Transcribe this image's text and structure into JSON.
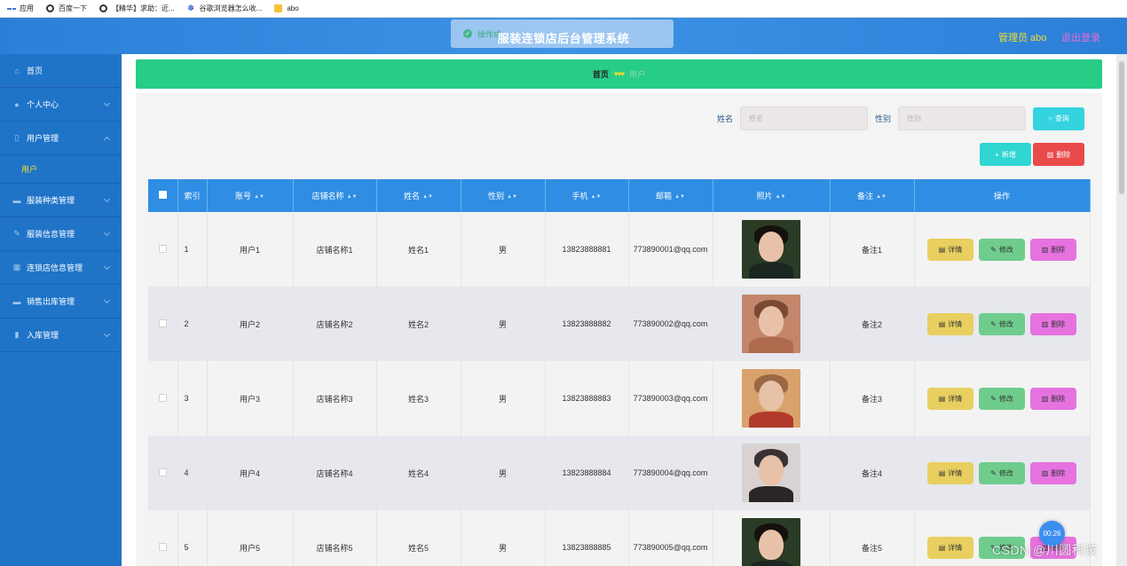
{
  "bookmarks": [
    {
      "label": "应用",
      "icon": "apps-grid-icon"
    },
    {
      "label": "百度一下",
      "icon": "globe-icon"
    },
    {
      "label": "【精华】求助：近...",
      "icon": "globe-icon"
    },
    {
      "label": "谷歌浏览器怎么收...",
      "icon": "paw-icon"
    },
    {
      "label": "abo",
      "icon": "folder-icon"
    }
  ],
  "header": {
    "title": "服装连锁店后台管理系统",
    "toast": "操作成",
    "user_label": "管理员 abo",
    "logout_label": "退出登录"
  },
  "sidebar": {
    "items": [
      {
        "label": "首页",
        "icon": "home-icon",
        "expanded": false,
        "has_children": false
      },
      {
        "label": "个人中心",
        "icon": "user-icon",
        "has_children": true
      },
      {
        "label": "用户管理",
        "icon": "mic-icon",
        "has_children": true,
        "expanded": true,
        "children": [
          {
            "label": "用户"
          }
        ]
      },
      {
        "label": "服装种类管理",
        "icon": "card-icon",
        "has_children": true
      },
      {
        "label": "服装信息管理",
        "icon": "edit-icon",
        "has_children": true
      },
      {
        "label": "连锁店信息管理",
        "icon": "grid-icon",
        "has_children": true
      },
      {
        "label": "销售出库管理",
        "icon": "card-icon",
        "has_children": true
      },
      {
        "label": "入库管理",
        "icon": "bar-chart-icon",
        "has_children": true
      }
    ]
  },
  "breadcrumb": {
    "home": "首页",
    "separator": "♥♥♥",
    "current": "用户"
  },
  "search": {
    "name_label": "姓名",
    "name_placeholder": "姓名",
    "gender_label": "性别",
    "gender_placeholder": "性别",
    "search_button": "查询"
  },
  "actions": {
    "add_button": "新增",
    "delete_button": "删除"
  },
  "table": {
    "columns": [
      "索引",
      "账号",
      "店铺名称",
      "姓名",
      "性别",
      "手机",
      "邮箱",
      "照片",
      "备注",
      "操作"
    ],
    "sortable": [
      false,
      true,
      true,
      true,
      true,
      true,
      true,
      true,
      true,
      false
    ],
    "rows": [
      {
        "index": "1",
        "account": "用户1",
        "store": "店铺名称1",
        "name": "姓名1",
        "gender": "男",
        "phone": "13823888881",
        "email": "773890001@qq.com",
        "note": "备注1",
        "photo": {
          "bg": "#2a3b26",
          "hair": "#15100c",
          "body": "#1c2620"
        }
      },
      {
        "index": "2",
        "account": "用户2",
        "store": "店铺名称2",
        "name": "姓名2",
        "gender": "男",
        "phone": "13823888882",
        "email": "773890002@qq.com",
        "note": "备注2",
        "photo": {
          "bg": "#c3866b",
          "hair": "#7b4a33",
          "body": "#b06a4e"
        }
      },
      {
        "index": "3",
        "account": "用户3",
        "store": "店铺名称3",
        "name": "姓名3",
        "gender": "男",
        "phone": "13823888883",
        "email": "773890003@qq.com",
        "note": "备注3",
        "photo": {
          "bg": "#d8a26c",
          "hair": "#9a6843",
          "body": "#b23a2b"
        }
      },
      {
        "index": "4",
        "account": "用户4",
        "store": "店铺名称4",
        "name": "姓名4",
        "gender": "男",
        "phone": "13823888884",
        "email": "773890004@qq.com",
        "note": "备注4",
        "photo": {
          "bg": "#d8d3d2",
          "hair": "#3a3232",
          "body": "#2b2626"
        }
      },
      {
        "index": "5",
        "account": "用户5",
        "store": "店铺名称5",
        "name": "姓名5",
        "gender": "男",
        "phone": "13823888885",
        "email": "773890005@qq.com",
        "note": "备注5",
        "photo": {
          "bg": "#2a3b26",
          "hair": "#15100c",
          "body": "#1c2620"
        }
      }
    ],
    "row_actions": {
      "detail": "详情",
      "edit": "修改",
      "delete": "删除"
    }
  },
  "overlay": {
    "timer": "00:26",
    "watermark": "CSDN @川圆科技"
  },
  "colors": {
    "header": "#2b7fd8",
    "sidebar": "#1f74c8",
    "breadcrumb": "#27cc87",
    "table_header": "#2f8ee3",
    "detail_button": "#e8cf5f",
    "edit_button": "#6fcc8d",
    "delete_button": "#e672df"
  }
}
